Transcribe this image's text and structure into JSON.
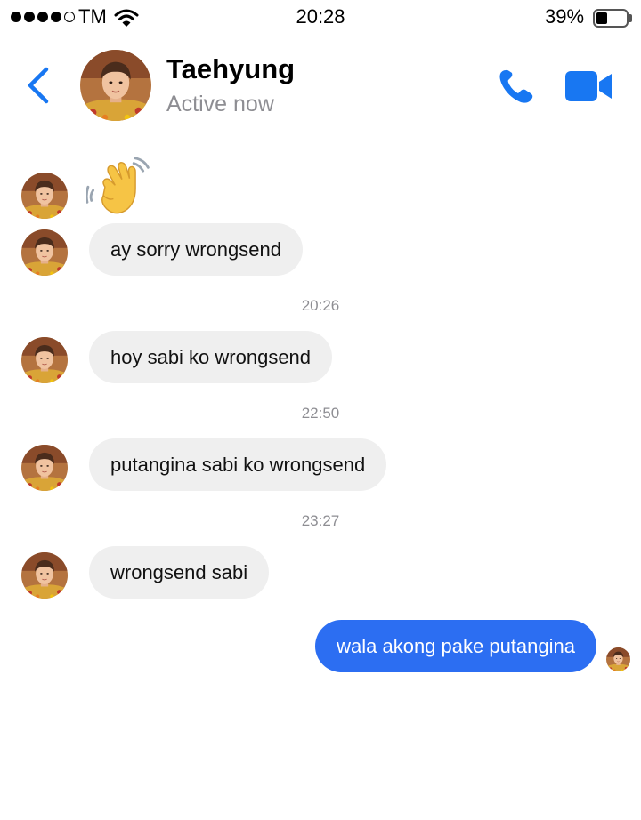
{
  "status_bar": {
    "carrier": "TM",
    "time": "20:28",
    "battery_percent": "39%",
    "signal_bars_filled": 4,
    "signal_bars_total": 5,
    "battery_level": 0.39
  },
  "header": {
    "contact_name": "Taehyung",
    "presence": "Active now",
    "icons": {
      "back": "chevron-left-icon",
      "call": "phone-icon",
      "video": "video-camera-icon"
    },
    "accent_color": "#1877f2"
  },
  "conversation": {
    "reaction_emoji": "👋",
    "messages": [
      {
        "kind": "incoming",
        "text": "ay sorry wrongsend"
      },
      {
        "kind": "timestamp",
        "text": "20:26"
      },
      {
        "kind": "incoming",
        "text": "hoy sabi ko wrongsend"
      },
      {
        "kind": "timestamp",
        "text": "22:50"
      },
      {
        "kind": "incoming",
        "text": "putangina sabi ko wrongsend"
      },
      {
        "kind": "timestamp",
        "text": "23:27"
      },
      {
        "kind": "incoming",
        "text": "wrongsend sabi"
      },
      {
        "kind": "outgoing",
        "text": "wala akong pake putangina"
      }
    ],
    "colors": {
      "incoming_bubble": "#efefef",
      "outgoing_bubble": "#2c6ef2",
      "timestamp": "#8e8e93"
    }
  }
}
